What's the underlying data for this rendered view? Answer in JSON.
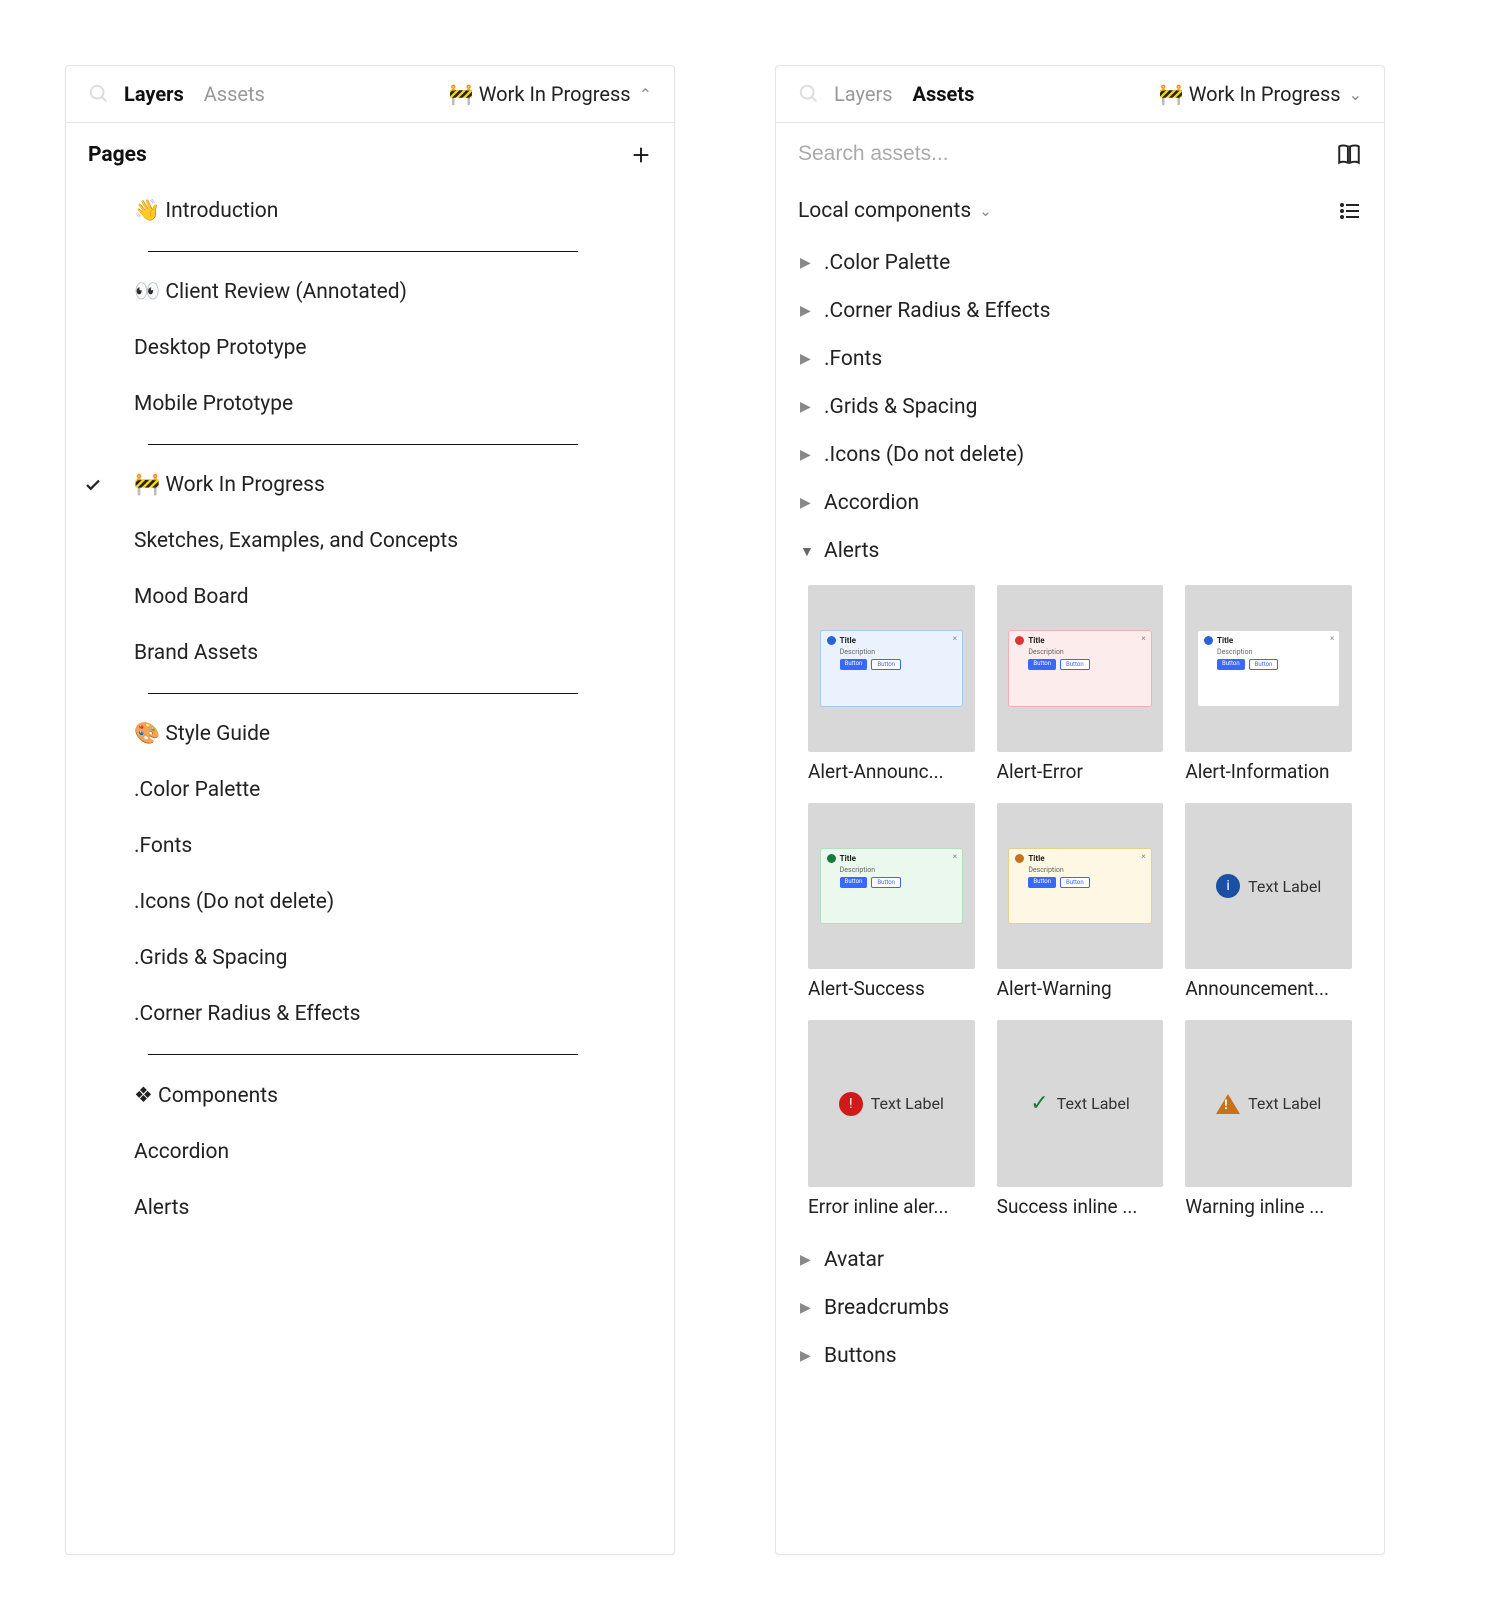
{
  "left": {
    "tabs": {
      "layers": "Layers",
      "assets": "Assets",
      "active": "layers"
    },
    "dropdown": "🚧 Work In Progress",
    "section": "Pages",
    "pages": [
      {
        "emoji": "👋",
        "label": "Introduction",
        "divider_after": true
      },
      {
        "emoji": "👀",
        "label": "Client Review (Annotated)"
      },
      {
        "emoji": "",
        "label": "Desktop Prototype"
      },
      {
        "emoji": "",
        "label": "Mobile Prototype",
        "divider_after": true
      },
      {
        "emoji": "🚧",
        "label": "Work In Progress",
        "checked": true
      },
      {
        "emoji": "",
        "label": "Sketches, Examples, and Concepts"
      },
      {
        "emoji": "",
        "label": "Mood Board"
      },
      {
        "emoji": "",
        "label": "Brand Assets",
        "divider_after": true
      },
      {
        "emoji": "🎨",
        "label": "Style Guide"
      },
      {
        "emoji": "",
        "label": ".Color Palette"
      },
      {
        "emoji": "",
        "label": ".Fonts"
      },
      {
        "emoji": "",
        "label": ".Icons (Do not delete)"
      },
      {
        "emoji": "",
        "label": ".Grids & Spacing"
      },
      {
        "emoji": "",
        "label": ".Corner Radius & Effects",
        "divider_after": true
      },
      {
        "emoji": "❖",
        "label": "Components"
      },
      {
        "emoji": "",
        "label": "Accordion"
      },
      {
        "emoji": "",
        "label": "Alerts"
      }
    ]
  },
  "right": {
    "tabs": {
      "layers": "Layers",
      "assets": "Assets",
      "active": "assets"
    },
    "dropdown": "🚧 Work In Progress",
    "search_placeholder": "Search assets...",
    "local_label": "Local components",
    "folders_before": [
      ".Color Palette",
      ".Corner Radius & Effects",
      ".Fonts",
      ".Grids & Spacing",
      ".Icons (Do not delete)",
      "Accordion"
    ],
    "open_folder": "Alerts",
    "thumbs": [
      {
        "label": "Alert-Announc...",
        "variant": "announce"
      },
      {
        "label": "Alert-Error",
        "variant": "error"
      },
      {
        "label": "Alert-Information",
        "variant": "info"
      },
      {
        "label": "Alert-Success",
        "variant": "success"
      },
      {
        "label": "Alert-Warning",
        "variant": "warning"
      },
      {
        "label": "Announcement...",
        "variant": "inline-info",
        "text": "Text Label"
      },
      {
        "label": "Error inline aler...",
        "variant": "inline-error",
        "text": "Text Label"
      },
      {
        "label": "Success inline ...",
        "variant": "inline-success",
        "text": "Text Label"
      },
      {
        "label": "Warning inline ...",
        "variant": "inline-warning",
        "text": "Text Label"
      }
    ],
    "folders_after": [
      "Avatar",
      "Breadcrumbs",
      "Buttons"
    ],
    "alert_sample": {
      "title": "Title",
      "desc": "Description",
      "btn1": "Button",
      "btn2": "Button"
    },
    "colors": {
      "announce": {
        "bg": "#eaf2fd",
        "border": "#a9c7ef",
        "dot": "#2962d9"
      },
      "error": {
        "bg": "#fdecec",
        "border": "#f2b1b1",
        "dot": "#d93636"
      },
      "info": {
        "bg": "#ffffff",
        "border": "#d9d9d9",
        "dot": "#2962d9"
      },
      "success": {
        "bg": "#eaf8ed",
        "border": "#b4dfbb",
        "dot": "#1a7a3a"
      },
      "warning": {
        "bg": "#fdf7e3",
        "border": "#e6d087",
        "dot": "#c5721a"
      },
      "inline_info_bg": "#1a4fa3",
      "inline_error_bg": "#d01a1a",
      "inline_warning_bg": "#c5721a"
    }
  }
}
